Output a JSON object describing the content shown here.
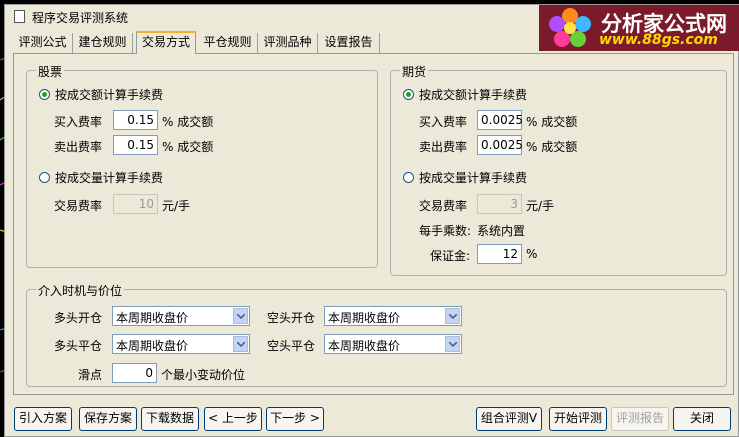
{
  "window": {
    "title": "程序交易评测系统"
  },
  "logo": {
    "text": "分析家公式网",
    "url": "www.88gs.com"
  },
  "tabs": [
    "评测公式",
    "建仓规则",
    "交易方式",
    "平仓规则",
    "评测品种",
    "设置报告"
  ],
  "active_tab": "交易方式",
  "stocks": {
    "legend": "股票",
    "by_amount": {
      "label": "按成交额计算手续费",
      "selected": true
    },
    "buy": {
      "label": "买入费率",
      "value": "0.15",
      "unit": "% 成交额"
    },
    "sell": {
      "label": "卖出费率",
      "value": "0.15",
      "unit": "% 成交额"
    },
    "by_volume": {
      "label": "按成交量计算手续费",
      "selected": false
    },
    "trade_fee": {
      "label": "交易费率",
      "value": "10",
      "unit": "元/手"
    }
  },
  "futures": {
    "legend": "期货",
    "by_amount": {
      "label": "按成交额计算手续费",
      "selected": true
    },
    "buy": {
      "label": "买入费率",
      "value": "0.0025",
      "unit": "% 成交额"
    },
    "sell": {
      "label": "卖出费率",
      "value": "0.0025",
      "unit": "% 成交额"
    },
    "by_volume": {
      "label": "按成交量计算手续费",
      "selected": false
    },
    "trade_fee": {
      "label": "交易费率",
      "value": "3",
      "unit": "元/手"
    },
    "multiplier": {
      "label": "每手乘数:",
      "value": "系统内置"
    },
    "margin": {
      "label": "保证金:",
      "value": "12",
      "unit": "%"
    }
  },
  "timing": {
    "legend": "介入时机与价位",
    "long_open": {
      "label": "多头开仓",
      "value": "本周期收盘价"
    },
    "short_open": {
      "label": "空头开仓",
      "value": "本周期收盘价"
    },
    "long_close": {
      "label": "多头平仓",
      "value": "本周期收盘价"
    },
    "short_close": {
      "label": "空头平仓",
      "value": "本周期收盘价"
    },
    "slippage": {
      "label": "滑点",
      "value": "0",
      "unit": "个最小变动价位"
    }
  },
  "buttons": {
    "import": "引入方案",
    "save": "保存方案",
    "download": "下载数据",
    "prev": "< 上一步",
    "next": "下一步 >",
    "combo": "组合评测V",
    "start": "开始评测",
    "report": "评测报告",
    "close": "关闭"
  },
  "colors": {
    "accent_tab": "#f0b030",
    "logo_bg": "#7a1a2a",
    "logo_url": "#ffd800",
    "radio_dot": "#21a121"
  }
}
